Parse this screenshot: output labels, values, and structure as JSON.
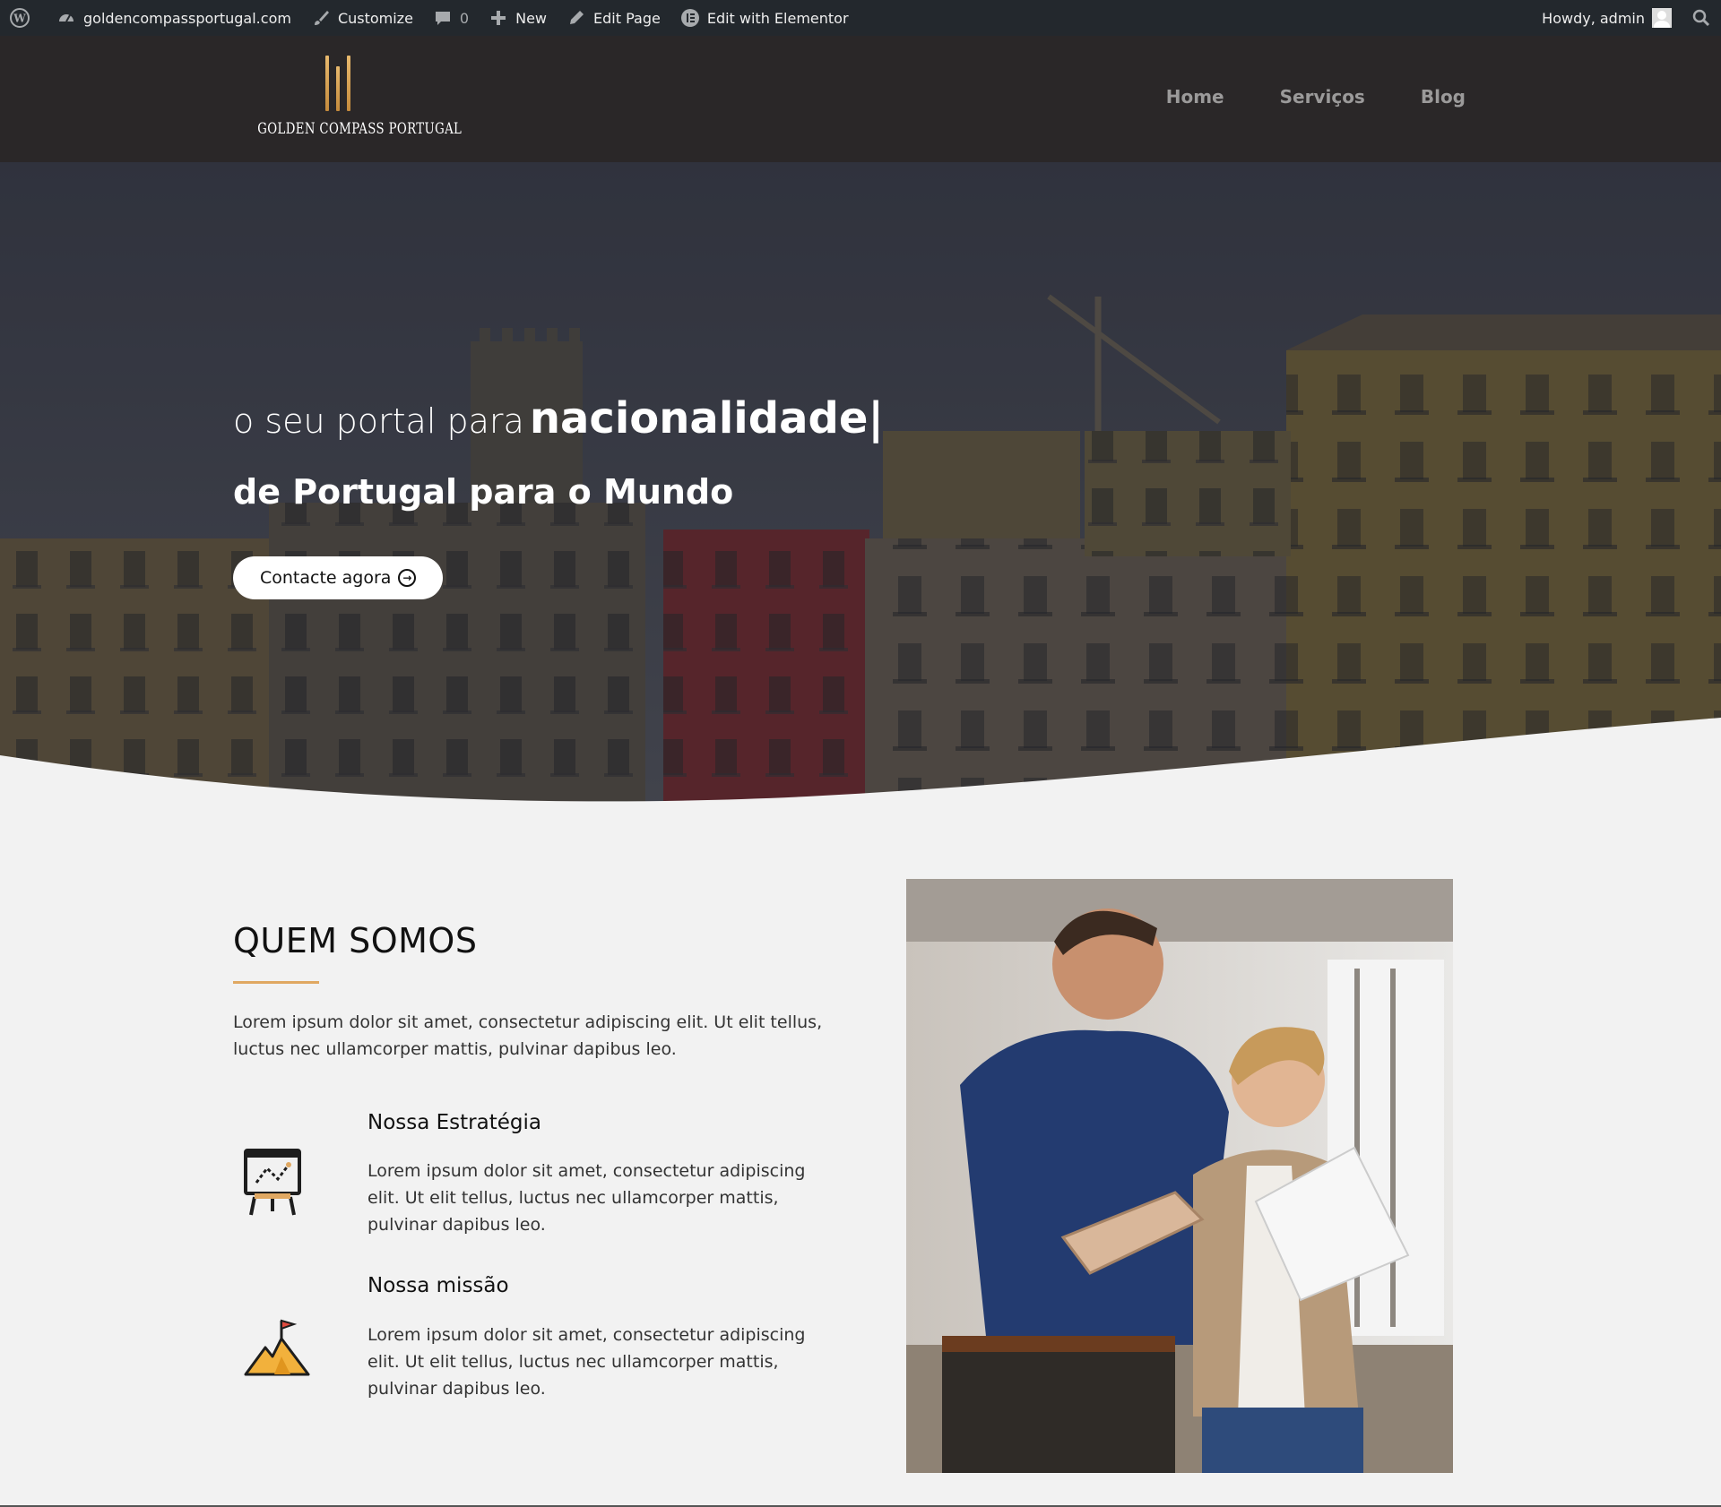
{
  "adminbar": {
    "site": "goldencompassportugal.com",
    "customize": "Customize",
    "comments_count": "0",
    "new": "New",
    "edit_page": "Edit Page",
    "edit_elementor": "Edit with Elementor",
    "greeting": "Howdy, admin"
  },
  "header": {
    "logo_text": "GOLDEN COMPASS PORTUGAL",
    "nav": [
      "Home",
      "Serviços",
      "Blog"
    ]
  },
  "hero": {
    "lead": "o seu portal para",
    "highlight": "nacionalidade|",
    "subtitle": "de Portugal para o Mundo",
    "cta": "Contacte agora"
  },
  "about": {
    "title": "QUEM SOMOS",
    "text": "Lorem ipsum dolor sit amet, consectetur adipiscing elit. Ut elit tellus, luctus nec ullamcorper mattis, pulvinar dapibus leo.",
    "features": [
      {
        "title": "Nossa Estratégia",
        "text": "Lorem ipsum dolor sit amet, consectetur adipiscing elit. Ut elit tellus, luctus nec ullamcorper mattis, pulvinar dapibus leo.",
        "icon": "strategy-board-icon"
      },
      {
        "title": "Nossa missão",
        "text": "Lorem ipsum dolor sit amet, consectetur adipiscing elit. Ut elit tellus, luctus nec ullamcorper mattis, pulvinar dapibus leo.",
        "icon": "mountain-flag-icon"
      }
    ]
  },
  "colors": {
    "admin_bar": "#23282d",
    "header_bg": "#2a2728",
    "accent_gold": "#e0a862",
    "page_bg": "#f2f2f2"
  }
}
